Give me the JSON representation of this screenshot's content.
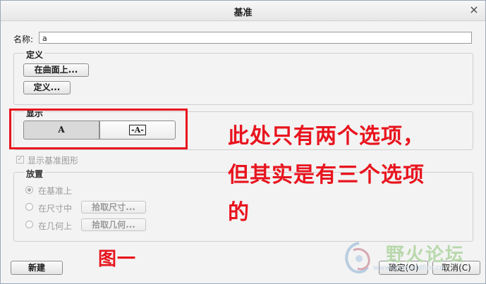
{
  "window": {
    "title": "基准",
    "close_glyph": "×"
  },
  "name_field": {
    "label": "名称:",
    "value": "a"
  },
  "definition": {
    "title": "定义",
    "on_surface_button": "在曲面上...",
    "define_button": "定义..."
  },
  "display": {
    "title": "显示",
    "option_a": "A",
    "option_boxed_a": "-A-"
  },
  "show_datum_checkbox": {
    "label": "显示基准图形",
    "checked": true,
    "enabled": false
  },
  "placement": {
    "title": "放置",
    "options": [
      {
        "label": "在基准上",
        "selected": true
      },
      {
        "label": "在尺寸中",
        "selected": false,
        "button": "拾取尺寸..."
      },
      {
        "label": "在几何上",
        "selected": false,
        "button": "拾取几何..."
      }
    ]
  },
  "footer": {
    "new_button": "新建",
    "ok_button": "确定(O)",
    "cancel_button": "取消(C)"
  },
  "annotation": {
    "note_line1": "此处只有两个选项，",
    "note_line2": "但其实是有三个选项",
    "note_line3": "的",
    "figure_label": "图一",
    "color": "#e8141e"
  },
  "watermark": {
    "text": "野火论坛",
    "url": "www.proewildfire.cn"
  }
}
